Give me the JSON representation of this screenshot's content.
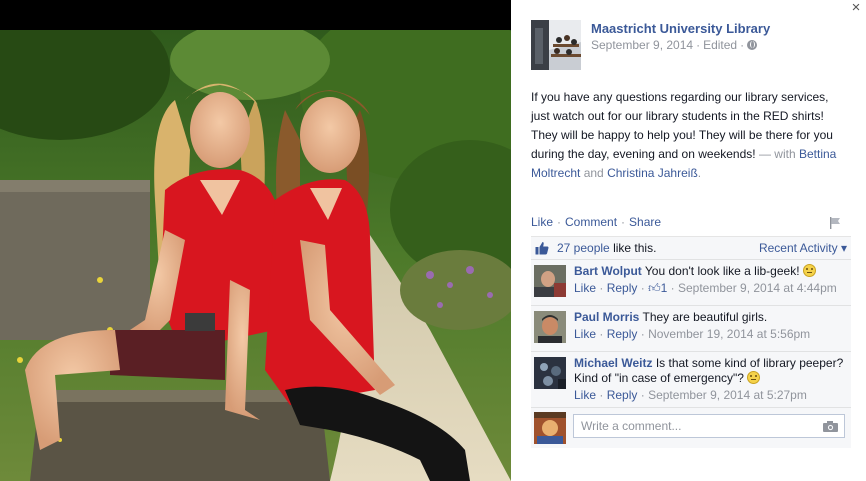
{
  "page": {
    "name": "Maastricht University Library",
    "date": "September 9, 2014",
    "edited": "Edited",
    "meta_sep": "·"
  },
  "post": {
    "text": "If you have any questions regarding our library services, just watch out for our library students in the RED shirts! They will be happy to help you! They will be there for you during the day, evening and on weekends!",
    "with_prefix": "— with",
    "tag1": "Bettina Moltrecht",
    "and": "and",
    "tag2": "Christina Jahreiß",
    "period": "."
  },
  "actions": {
    "like": "Like",
    "comment": "Comment",
    "share": "Share",
    "sep": "·"
  },
  "likes": {
    "count_text": "27 people",
    "suffix": "like this.",
    "recent_activity": "Recent Activity ▾"
  },
  "comments": [
    {
      "author": "Bart Wolput",
      "text": "You don't look like a lib-geek!",
      "like": "Like",
      "reply": "Reply",
      "like_count": "1",
      "time": "September 9, 2014 at 4:44pm"
    },
    {
      "author": "Paul Morris",
      "text": "They are beautiful girls.",
      "like": "Like",
      "reply": "Reply",
      "time": "November 19, 2014 at 5:56pm"
    },
    {
      "author": "Michael Weitz",
      "text": "Is that some kind of library peeper? Kind of \"in case of emergency\"?",
      "like": "Like",
      "reply": "Reply",
      "time": "September 9, 2014 at 5:27pm"
    }
  ],
  "composer": {
    "placeholder": "Write a comment..."
  },
  "ui": {
    "close": "×",
    "dot": "·"
  },
  "colors": {
    "link": "#3b5998",
    "meta": "#90949c",
    "ufi_bg": "#f6f7f9",
    "shirt_red": "#d8161f"
  }
}
